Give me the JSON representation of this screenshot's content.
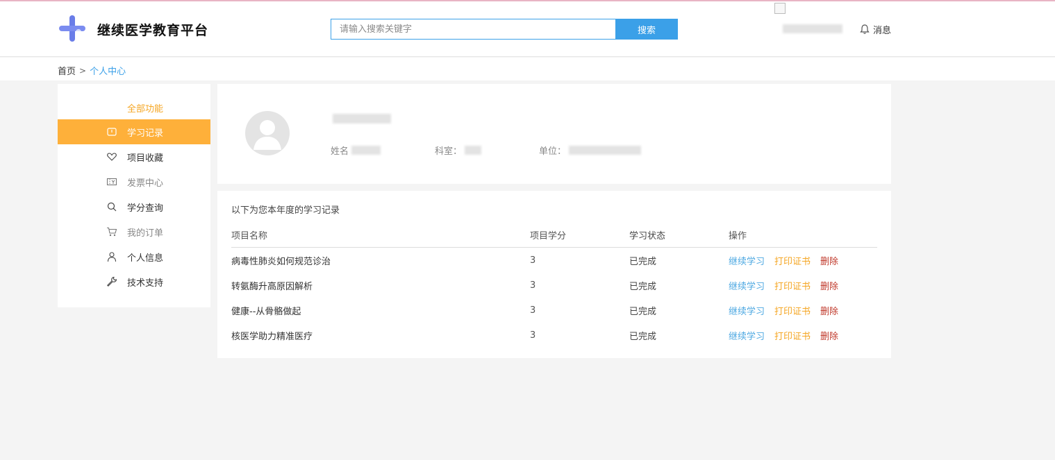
{
  "colors": {
    "primary": "#3ba0e8",
    "accent": "#feb03a",
    "orange_text": "#f5a623",
    "danger": "#c0392b",
    "logo_blue": "#6a7de8"
  },
  "header": {
    "site_title": "继续医学教育平台",
    "search_placeholder": "请输入搜索关键字",
    "search_button": "搜索",
    "messages_label": "消息",
    "logo_icon": "medical-cross-logo",
    "bell_icon": "bell-icon"
  },
  "breadcrumb": {
    "home": "首页",
    "separator": ">",
    "current": "个人中心"
  },
  "sidebar": {
    "heading": "全部功能",
    "items": [
      {
        "label": "学习记录",
        "icon": "clipboard-icon",
        "active": true
      },
      {
        "label": "项目收藏",
        "icon": "heart-icon"
      },
      {
        "label": "发票中心",
        "icon": "ticket-icon"
      },
      {
        "label": "学分查询",
        "icon": "search-icon"
      },
      {
        "label": "我的订单",
        "icon": "cart-icon"
      },
      {
        "label": "个人信息",
        "icon": "user-icon"
      },
      {
        "label": "技术支持",
        "icon": "wrench-icon"
      }
    ]
  },
  "profile": {
    "name_label": "姓名",
    "department_label": "科室：",
    "unit_label": "单位："
  },
  "records": {
    "title": "以下为您本年度的学习记录",
    "columns": [
      "项目名称",
      "项目学分",
      "学习状态",
      "操作"
    ],
    "rows": [
      {
        "name": "病毒性肺炎如何规范诊治",
        "credits": "3",
        "status": "已完成"
      },
      {
        "name": "转氨酶升高原因解析",
        "credits": "3",
        "status": "已完成"
      },
      {
        "name": "健康--从骨骼做起",
        "credits": "3",
        "status": "已完成"
      },
      {
        "name": "核医学助力精准医疗",
        "credits": "3",
        "status": "已完成"
      }
    ],
    "actions": {
      "continue": "继续学习",
      "print": "打印证书",
      "delete": "删除"
    }
  }
}
